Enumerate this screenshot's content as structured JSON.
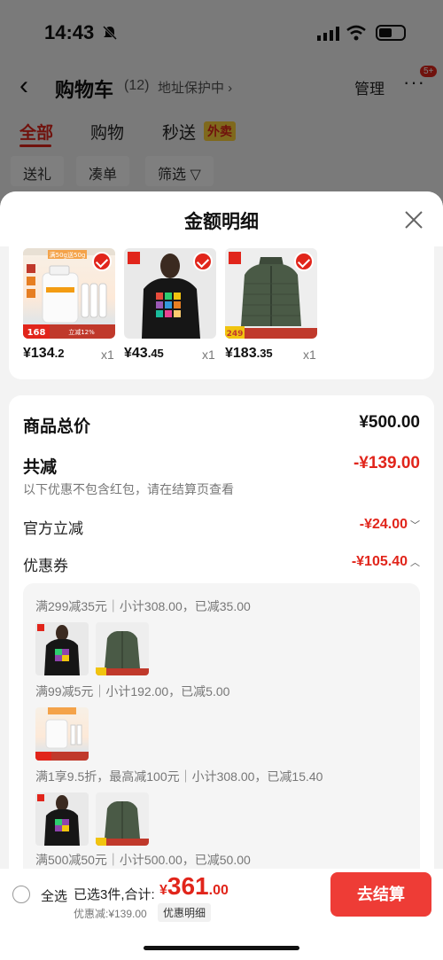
{
  "status_bar": {
    "time": "14:43"
  },
  "nav": {
    "title": "购物车",
    "count": "(12)",
    "address": "地址保护中 ›",
    "manage": "管理",
    "more_badge": "5+"
  },
  "tabs": [
    {
      "label": "全部"
    },
    {
      "label": "购物"
    },
    {
      "label": "秒送"
    }
  ],
  "tab_badge": "外卖",
  "filters": [
    {
      "label": "送礼"
    },
    {
      "label": "凑单"
    },
    {
      "label": "筛选 ▽"
    }
  ],
  "sheet": {
    "title": "金额明细"
  },
  "products": [
    {
      "name": "milk-powder",
      "price_int": "¥134",
      "price_dec": ".2",
      "qty": "x1",
      "tag": "168",
      "banner": "立减12%",
      "promo": "满50g送50g"
    },
    {
      "name": "t-shirt",
      "price_int": "¥43",
      "price_dec": ".45",
      "qty": "x1"
    },
    {
      "name": "down-jacket",
      "price_int": "¥183",
      "price_dec": ".35",
      "qty": "x1",
      "tag": "249"
    }
  ],
  "summary": {
    "total_label": "商品总价",
    "total_value": "¥500.00",
    "reduce_label": "共减",
    "reduce_value": "-¥139.00",
    "note": "以下优惠不包含红包，请在结算页查看",
    "official_label": "官方立减",
    "official_value": "-¥24.00",
    "coupon_label": "优惠券",
    "coupon_value": "-¥105.40"
  },
  "coupons": [
    {
      "line": "满299减35元｜小计308.00，已减35.00"
    },
    {
      "line": "满99减5元｜小计192.00，已减5.00"
    },
    {
      "line": "满1享9.5折，最高减100元｜小计308.00，已减15.40"
    },
    {
      "line": "满500减50元｜小计500.00，已减50.00"
    }
  ],
  "bottom": {
    "select_all": "全选",
    "selected": "已选3件,合计:",
    "yen": "¥",
    "total_int": "361",
    "total_dec": ".00",
    "discount": "优惠减:¥139.00",
    "detail": "优惠明细",
    "checkout": "去结算"
  },
  "colors": {
    "accent": "#e1251b",
    "checkout": "#ee3c36"
  }
}
